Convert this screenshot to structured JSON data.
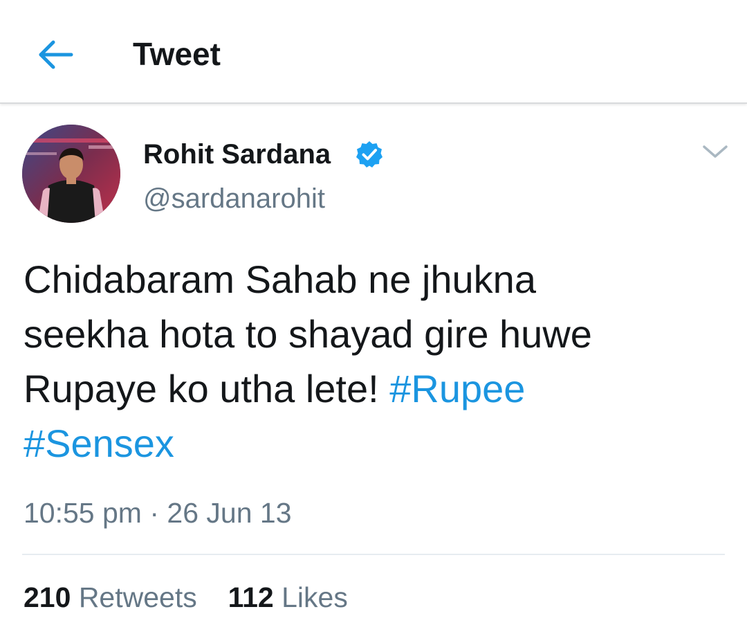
{
  "header": {
    "title": "Tweet",
    "back_icon": "arrow-left-icon"
  },
  "tweet": {
    "author": {
      "name": "Rohit Sardana",
      "handle": "@sardanarohit",
      "verified": true
    },
    "text_lines": [
      "Chidabaram Sahab ne jhukna",
      "seekha hota to shayad gire huwe",
      "Rupaye ko utha lete! "
    ],
    "hashtags": [
      "#Rupee",
      "#Sensex"
    ],
    "time": "10:55 pm",
    "separator": "·",
    "date": "26 Jun 13",
    "retweets": {
      "count": "210",
      "label": "Retweets"
    },
    "likes": {
      "count": "112",
      "label": "Likes"
    }
  },
  "colors": {
    "accent": "#1b95e0",
    "verified_badge": "#1da1f2",
    "muted_text": "#657786",
    "primary_text": "#14171a"
  }
}
